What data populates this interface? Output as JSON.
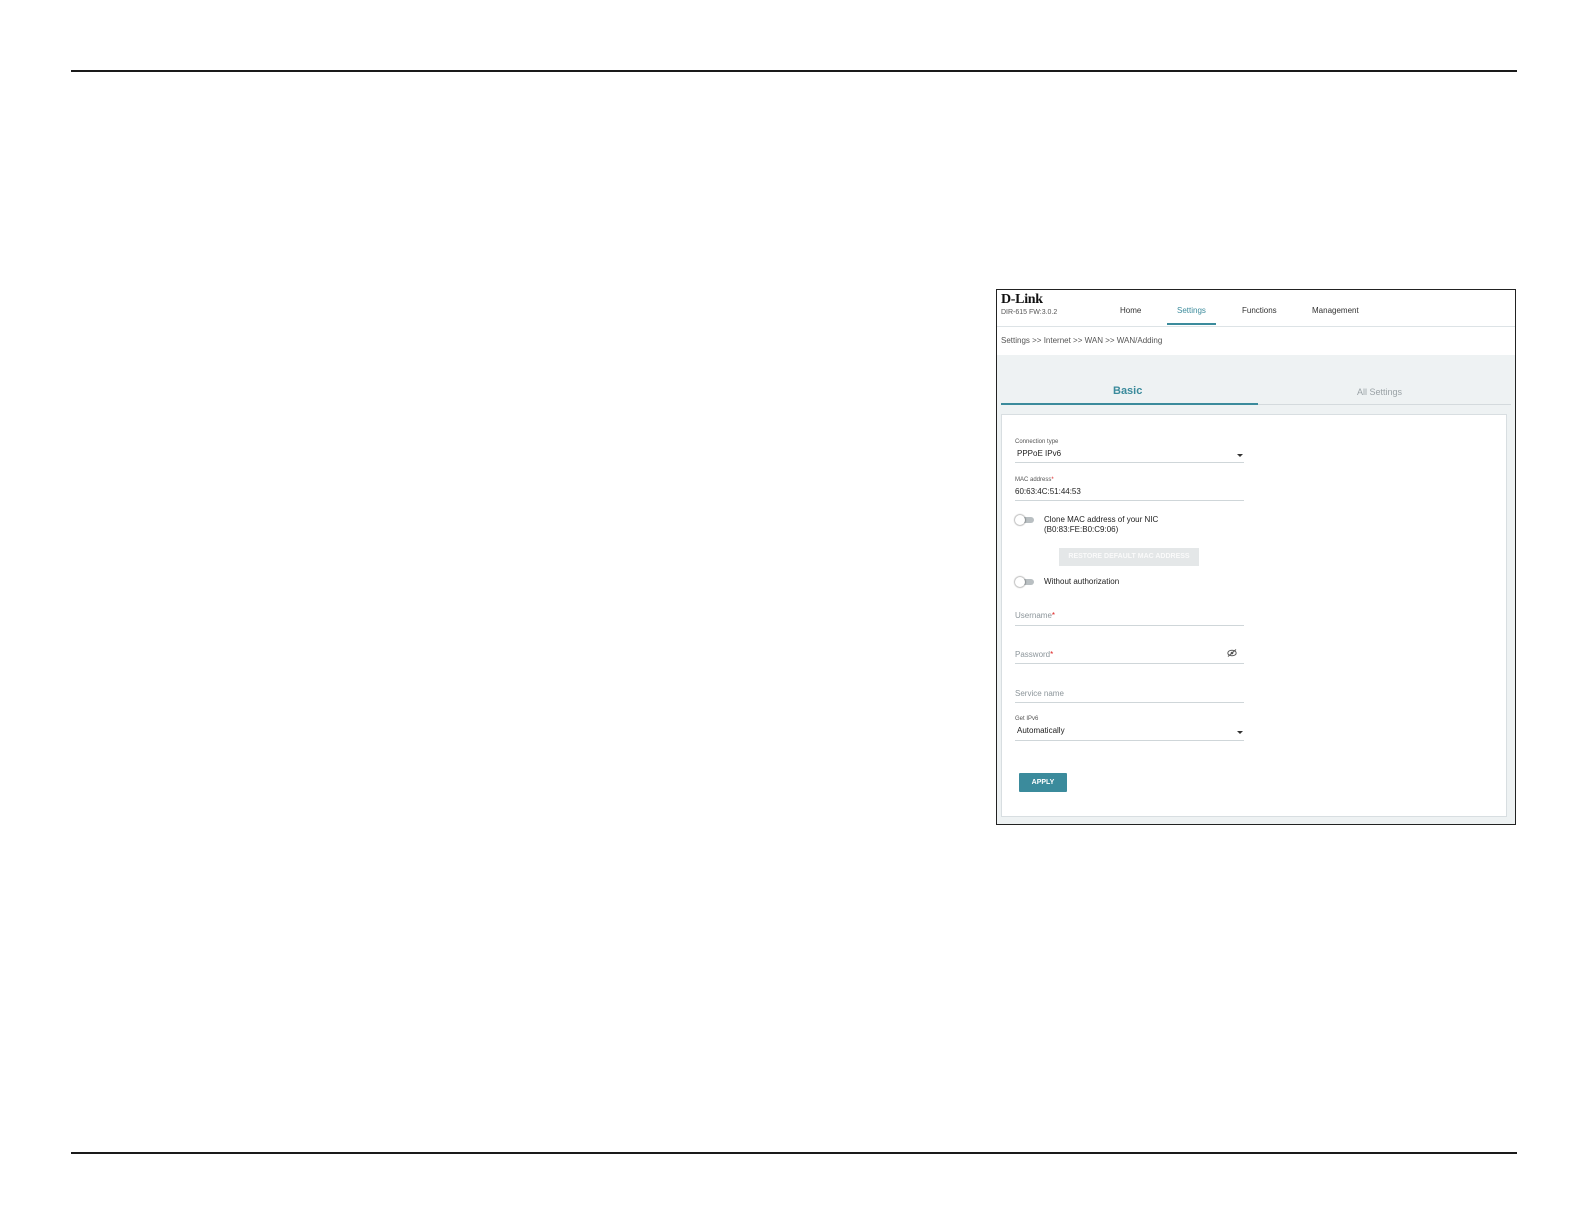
{
  "header": {
    "logo": "D-Link",
    "model": "DIR-615 FW:3.0.2",
    "nav": [
      {
        "label": "Home"
      },
      {
        "label": "Settings"
      },
      {
        "label": "Functions"
      },
      {
        "label": "Management"
      }
    ],
    "active_nav": "Settings"
  },
  "breadcrumb": "Settings >> Internet >> WAN >> WAN/Adding",
  "tabs": [
    {
      "label": "Basic"
    },
    {
      "label": "All Settings"
    }
  ],
  "active_tab": "Basic",
  "form": {
    "connection_type": {
      "label": "Connection type",
      "value": "PPPoE IPv6"
    },
    "mac_address": {
      "label": "MAC address",
      "required_mark": "*",
      "value": "60:63:4C:51:44:53"
    },
    "clone_mac": {
      "label_line1": "Clone MAC address of your NIC",
      "label_line2": "(B0:83:FE:B0:C9:06)",
      "enabled": false
    },
    "restore_button": "RESTORE DEFAULT MAC ADDRESS",
    "without_auth": {
      "label": "Without authorization",
      "enabled": false
    },
    "username": {
      "placeholder": "Username",
      "required_mark": "*"
    },
    "password": {
      "placeholder": "Password",
      "required_mark": "*",
      "icon": "eye-off-icon"
    },
    "service_name": {
      "placeholder": "Service name"
    },
    "get_ipv6": {
      "label": "Get IPv6",
      "value": "Automatically"
    },
    "apply_button": "APPLY"
  },
  "colors": {
    "accent": "#3b8b9c",
    "required": "#d22222",
    "disabled_button": "#e4e7e8"
  }
}
